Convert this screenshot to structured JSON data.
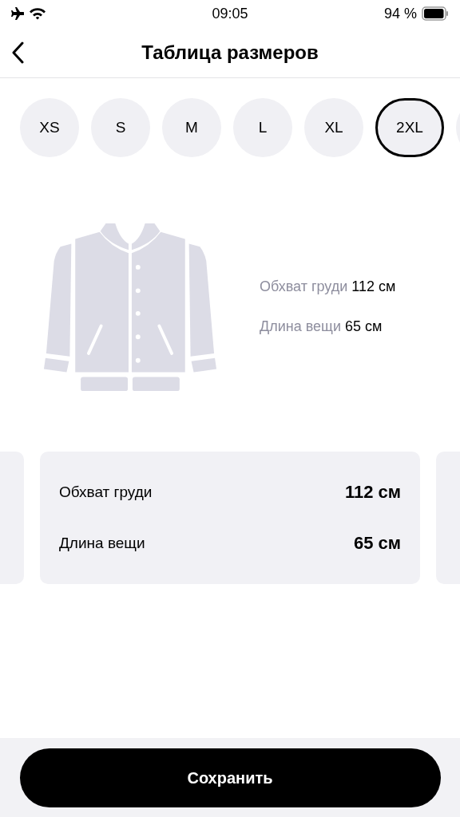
{
  "status_bar": {
    "time": "09:05",
    "battery": "94 %"
  },
  "header": {
    "title": "Таблица размеров"
  },
  "sizes": [
    {
      "label": "XS",
      "selected": false
    },
    {
      "label": "S",
      "selected": false
    },
    {
      "label": "M",
      "selected": false
    },
    {
      "label": "L",
      "selected": false
    },
    {
      "label": "XL",
      "selected": false
    },
    {
      "label": "2XL",
      "selected": true
    }
  ],
  "summary": [
    {
      "label": "Обхват груди",
      "value": "112 см"
    },
    {
      "label": "Длина вещи",
      "value": "65 см"
    }
  ],
  "card": {
    "rows": [
      {
        "label": "Обхват груди",
        "value": "112 см"
      },
      {
        "label": "Длина вещи",
        "value": "65 см"
      }
    ]
  },
  "save_button": "Сохранить"
}
